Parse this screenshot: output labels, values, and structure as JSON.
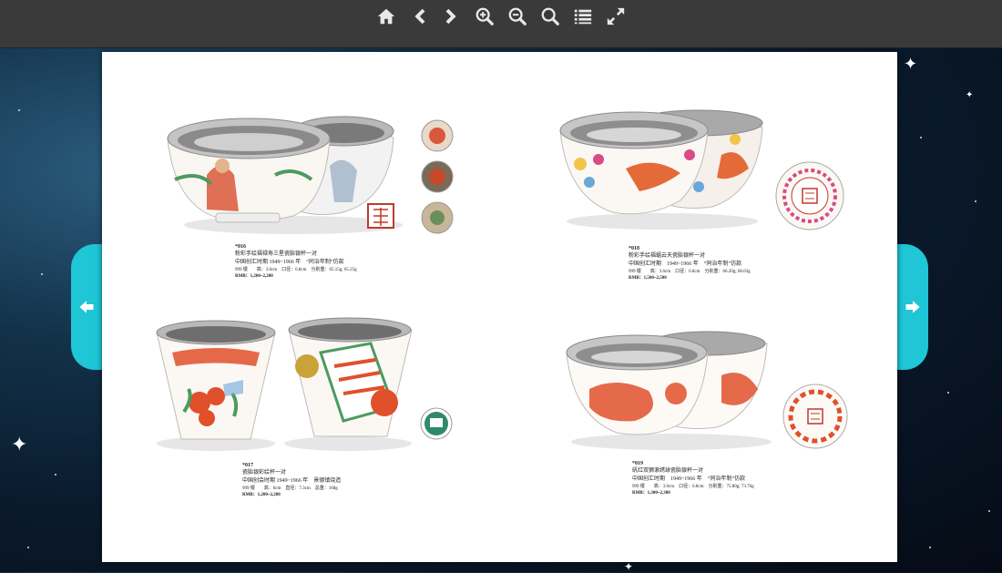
{
  "toolbar": {
    "buttons": [
      {
        "name": "home",
        "icon": "home-icon"
      },
      {
        "name": "previous",
        "icon": "chevron-left-icon"
      },
      {
        "name": "next",
        "icon": "chevron-right-icon"
      },
      {
        "name": "zoom-in",
        "icon": "zoom-in-icon"
      },
      {
        "name": "zoom-out",
        "icon": "zoom-out-icon"
      },
      {
        "name": "search",
        "icon": "search-icon"
      },
      {
        "name": "table-of-contents",
        "icon": "list-icon"
      },
      {
        "name": "fullscreen",
        "icon": "fullscreen-icon"
      }
    ]
  },
  "navigation": {
    "prev_icon": "arrow-left-icon",
    "next_icon": "arrow-right-icon",
    "accent_color": "#1ec6d6"
  },
  "lots": [
    {
      "lot": "*016",
      "title": "粉彩手绘福禄寿三星瓷胎银杯一对",
      "period": "中国创汇时期 1949~1966 年　“同治年制”仿款",
      "spec": "999 银　　高：3.6cm　口径：6.8cm　分别重：65.15g; 65.25g",
      "estimate": "RMB：1,200~2,200"
    },
    {
      "lot": "*018",
      "title": "粉彩手绘福蝠云天瓷胎银杯一对",
      "period": "中国创汇时期　1949~1966 年　“同治年制”仿款",
      "spec": "999 银　　高：3.6cm　口径：6.8cm　分别重：66.20g; 68.03g",
      "estimate": "RMB：1,500~2,500"
    },
    {
      "lot": "*017",
      "title": "瓷胎银彩绘杯一对",
      "period": "中国创会时期 1949~1966 年　景德镇烧造",
      "spec": "999 银　　高：6cm　直径：7.3cm　总重：168g",
      "estimate": "RMB：1,200~2,200"
    },
    {
      "lot": "*019",
      "title": "矾红双狮滚绣球瓷胎银杯一对",
      "period": "中国创汇时期　1949~1966 年　“同治年制”仿款",
      "spec": "999 银　　高：3.6cm　口径：6.8cm　分别重：75.80g; 73.76g",
      "estimate": "RMB：1,300~2,300"
    }
  ],
  "colors": {
    "toolbar": "#3a3a3a",
    "iron_red": "#e0502a",
    "silver": "#c9c9c9"
  }
}
